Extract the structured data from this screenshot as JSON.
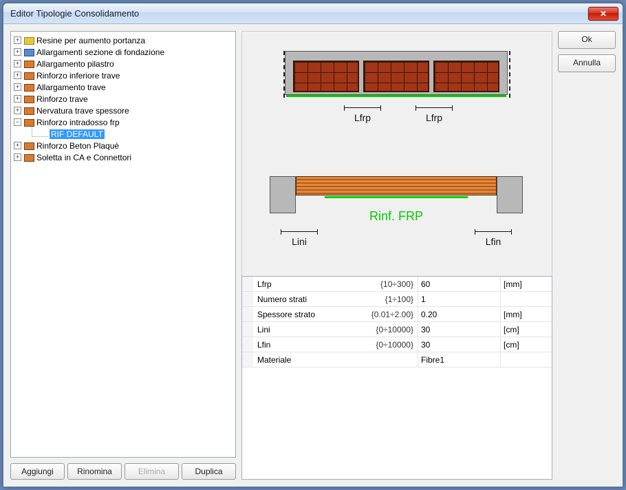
{
  "window": {
    "title": "Editor Tipologie Consolidamento"
  },
  "tree": {
    "items": [
      {
        "label": "Resine per aumento portanza",
        "expander": "+",
        "icon": "yellow"
      },
      {
        "label": "Allargamenti sezione di fondazione",
        "expander": "+",
        "icon": "blue"
      },
      {
        "label": "Allargamento pilastro",
        "expander": "+",
        "icon": "orange"
      },
      {
        "label": "Rinforzo inferiore trave",
        "expander": "+",
        "icon": "orange"
      },
      {
        "label": "Allargamento trave",
        "expander": "+",
        "icon": "orange"
      },
      {
        "label": "Rinforzo trave",
        "expander": "+",
        "icon": "orange"
      },
      {
        "label": "Nervatura trave spessore",
        "expander": "+",
        "icon": "orange"
      },
      {
        "label": "Rinforzo intradosso frp",
        "expander": "−",
        "icon": "orange",
        "child": "RIF DEFAULT"
      },
      {
        "label": "Rinforzo Beton Plaquè",
        "expander": "+",
        "icon": "orange"
      },
      {
        "label": "Soletta in CA e Connettori",
        "expander": "+",
        "icon": "orange"
      }
    ]
  },
  "left_buttons": {
    "add": "Aggiungi",
    "rename": "Rinomina",
    "delete": "Elimina",
    "duplicate": "Duplica"
  },
  "right_buttons": {
    "ok": "Ok",
    "cancel": "Annulla"
  },
  "diagram": {
    "lfrp1": "Lfrp",
    "lfrp2": "Lfrp",
    "rinf_label": "Rinf. FRP",
    "lini": "Lini",
    "lfin": "Lfin"
  },
  "params": [
    {
      "name": "Lfrp",
      "range": "{10÷300}",
      "value": "60",
      "unit": "[mm]"
    },
    {
      "name": "Numero strati",
      "range": "{1÷100}",
      "value": "1",
      "unit": ""
    },
    {
      "name": "Spessore strato",
      "range": "{0.01÷2.00}",
      "value": "0.20",
      "unit": "[mm]"
    },
    {
      "name": "Lini",
      "range": "{0÷10000}",
      "value": "30",
      "unit": "[cm]"
    },
    {
      "name": "Lfin",
      "range": "{0÷10000}",
      "value": "30",
      "unit": "[cm]"
    },
    {
      "name": "Materiale",
      "range": "",
      "value": "Fibre1",
      "unit": ""
    }
  ]
}
